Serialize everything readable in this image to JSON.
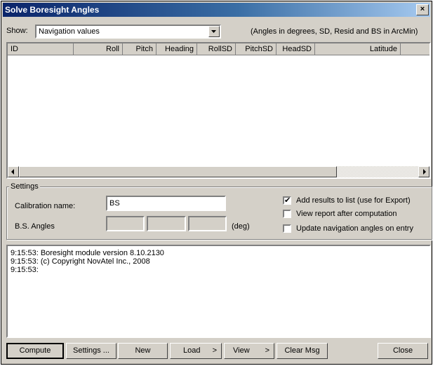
{
  "window": {
    "title": "Solve Boresight Angles",
    "close_glyph": "×"
  },
  "show": {
    "label": "Show:",
    "selected": "Navigation values",
    "note": "(Angles in degrees, SD, Resid and BS in ArcMin)"
  },
  "table": {
    "columns": [
      "ID",
      "Roll",
      "Pitch",
      "Heading",
      "RollSD",
      "PitchSD",
      "HeadSD",
      "Latitude"
    ]
  },
  "settings": {
    "group_label": "Settings",
    "calibration_label": "Calibration name:",
    "calibration_value": "BS",
    "bs_angles_label": "B.S. Angles",
    "bs_unit": "(deg)",
    "options": [
      {
        "label": "Add results to list (use for Export)",
        "checked": true
      },
      {
        "label": "View report after computation",
        "checked": false
      },
      {
        "label": "Update navigation angles on entry",
        "checked": false
      }
    ]
  },
  "log": [
    "9:15:53: Boresight module version 8.10.2130",
    "9:15:53: (c) Copyright NovAtel Inc., 2008",
    "9:15:53:"
  ],
  "buttons": {
    "compute": "Compute",
    "settings": "Settings ...",
    "new": "New",
    "load": "Load",
    "view": "View",
    "clear": "Clear Msg",
    "close": "Close",
    "arrow": ">"
  }
}
